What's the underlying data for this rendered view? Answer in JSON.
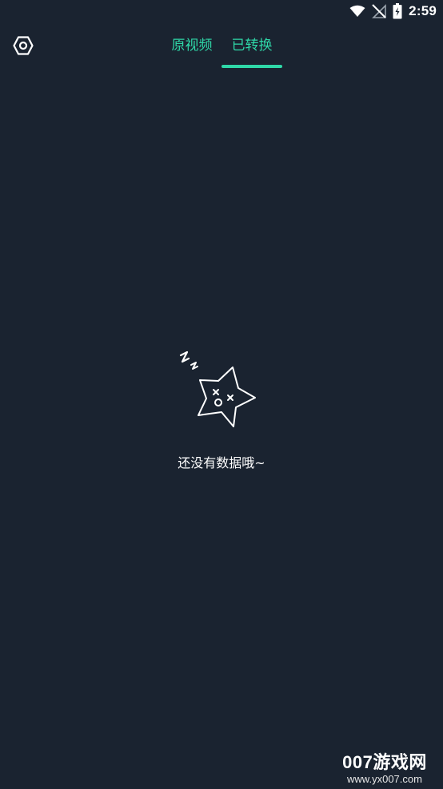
{
  "status_bar": {
    "time": "2:59",
    "icons": [
      "wifi-icon",
      "signal-off-icon",
      "battery-icon"
    ]
  },
  "header": {
    "settings_icon": "settings-hex-icon",
    "tabs": [
      {
        "label": "原视频",
        "active": false
      },
      {
        "label": "已转换",
        "active": true
      }
    ]
  },
  "empty_state": {
    "icon": "sleeping-star-icon",
    "message": "还没有数据哦~"
  },
  "watermark": {
    "logo": "007游戏网",
    "url": "www.yx007.com"
  },
  "colors": {
    "background": "#1a2330",
    "accent": "#2fd8a8",
    "text": "#ffffff"
  }
}
